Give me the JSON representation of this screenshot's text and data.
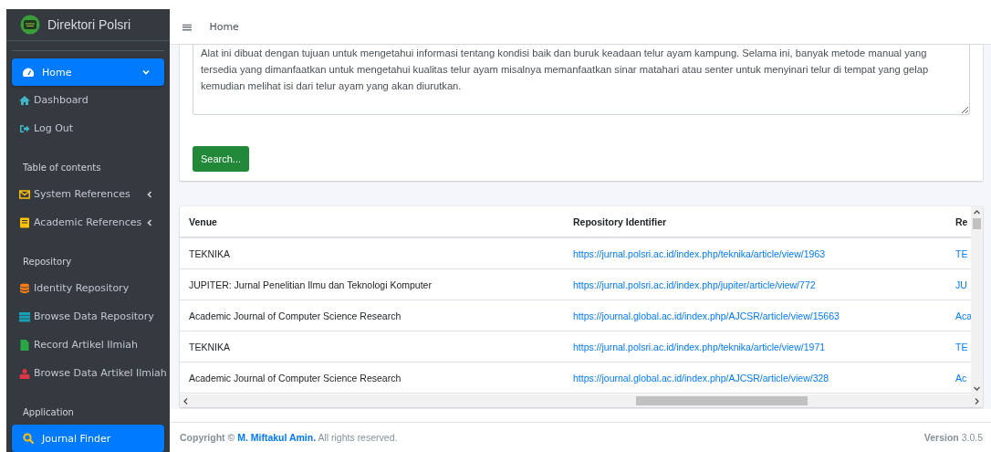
{
  "brand": {
    "title": "Direktori Polsri"
  },
  "sidebar": {
    "items": [
      {
        "kind": "link",
        "label": "Home",
        "selected": true,
        "expanded": true
      },
      {
        "kind": "link",
        "label": "Dashboard",
        "selected": false
      },
      {
        "kind": "link",
        "label": "Log Out",
        "selected": false
      },
      {
        "kind": "header",
        "label": "Table of contents"
      },
      {
        "kind": "link",
        "label": "System References",
        "selected": false,
        "expanded": false
      },
      {
        "kind": "link",
        "label": "Academic References",
        "selected": false,
        "expanded": false
      },
      {
        "kind": "header",
        "label": "Repository"
      },
      {
        "kind": "link",
        "label": "Identity Repository",
        "selected": false
      },
      {
        "kind": "link",
        "label": "Browse Data Repository",
        "selected": false
      },
      {
        "kind": "link",
        "label": "Record Artikel Ilmiah",
        "selected": false
      },
      {
        "kind": "link",
        "label": "Browse Data Artikel Ilmiah",
        "selected": false
      },
      {
        "kind": "header",
        "label": "Application"
      },
      {
        "kind": "link",
        "label": "Journal Finder",
        "selected": true
      }
    ]
  },
  "header": {
    "menu_glyph": "≡",
    "breadcrumb": "Home"
  },
  "search_form": {
    "text": "Alat ini dibuat dengan tujuan untuk mengetahui informasi tentang kondisi baik dan buruk keadaan telur ayam kampung. Selama ini, banyak metode manual yang tersedia yang dimanfaatkan untuk mengetahui kualitas telur ayam misalnya memanfaatkan sinar matahari atau senter untuk menyinari telur di tempat yang gelap kemudian melihat isi dari telur ayam yang akan diurutkan.",
    "button": "Search..."
  },
  "table": {
    "columns": [
      "Venue",
      "Repository Identifier",
      "Re"
    ],
    "rows": [
      [
        "TEKNIKA",
        "https://jurnal.polsri.ac.id/index.php/teknika/article/view/1963",
        "TE"
      ],
      [
        "JUPITER: Jurnal Penelitian Ilmu dan Teknologi Komputer",
        "https://jurnal.polsri.ac.id/index.php/jupiter/article/view/772",
        "JU"
      ],
      [
        "Academic Journal of Computer Science Research",
        "https://journal.global.ac.id/index.php/AJCSR/article/view/15663",
        "Aca"
      ],
      [
        "TEKNIKA",
        "https://jurnal.polsri.ac.id/index.php/teknika/article/view/1971",
        "TE"
      ],
      [
        "Academic Journal of Computer Science Research",
        "https://journal.global.ac.id/index.php/AJCSR/article/view/328",
        "Ac"
      ]
    ]
  },
  "footer": {
    "copyright": "Copyright ©",
    "author": "M. Miftakul Amin.",
    "rights": "All rights reserved.",
    "version": "**Version** 3.0.5"
  }
}
